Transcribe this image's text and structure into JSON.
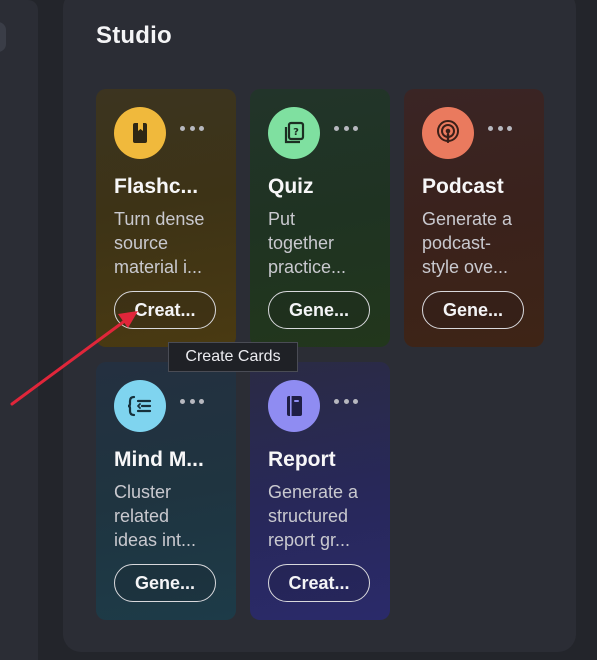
{
  "studio": {
    "title": "Studio",
    "cards": [
      {
        "title": "Flashc...",
        "desc": [
          "Turn dense",
          "source",
          "material i..."
        ],
        "button": "Creat...",
        "icon": "flashcards-icon"
      },
      {
        "title": "Quiz",
        "desc": [
          "Put",
          "together",
          "practice..."
        ],
        "button": "Gene...",
        "icon": "quiz-icon"
      },
      {
        "title": "Podcast",
        "desc": [
          "Generate a",
          "podcast-",
          "style ove..."
        ],
        "button": "Gene...",
        "icon": "podcast-icon"
      },
      {
        "title": "Mind M...",
        "desc": [
          "Cluster",
          "related",
          "ideas int..."
        ],
        "button": "Gene...",
        "icon": "mind-map-icon"
      },
      {
        "title": "Report",
        "desc": [
          "Generate a",
          "structured",
          "report gr..."
        ],
        "button": "Creat...",
        "icon": "report-icon"
      }
    ]
  },
  "tooltip": "Create Cards",
  "colors": {
    "flashcards_accent": "#f0b93c",
    "quiz_accent": "#7fe0a0",
    "podcast_accent": "#ea7a5e",
    "mind_map_accent": "#7fd4ef",
    "report_accent": "#8f8cf2",
    "annotation_arrow": "#e0263a"
  }
}
